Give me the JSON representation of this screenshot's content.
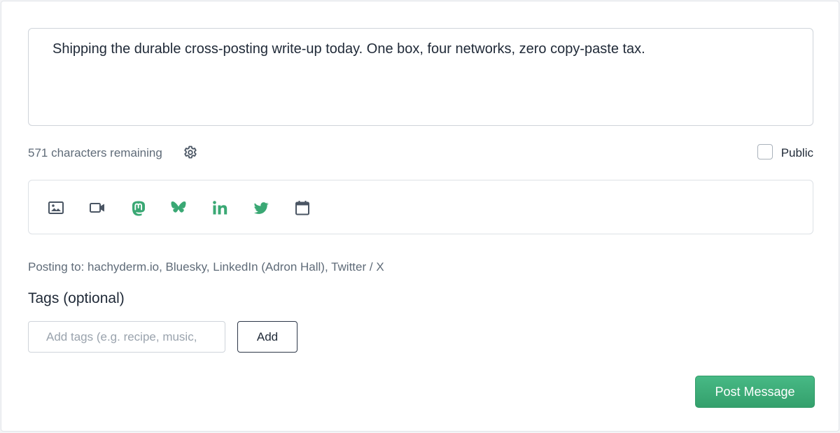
{
  "composer": {
    "text": "Shipping the durable cross-posting write-up today. One box, four networks, zero copy-paste tax."
  },
  "meta": {
    "char_count": "571 characters remaining",
    "public_label": "Public",
    "public_checked": false
  },
  "toolbar": {
    "icons": [
      "image-icon",
      "video-icon",
      "mastodon-icon",
      "bluesky-icon",
      "linkedin-icon",
      "twitter-icon",
      "calendar-icon"
    ]
  },
  "posting": {
    "text": "Posting to: hachyderm.io, Bluesky, LinkedIn (Adron Hall), Twitter / X"
  },
  "tags": {
    "heading": "Tags (optional)",
    "placeholder": "Add tags (e.g. recipe, music, ",
    "add_label": "Add"
  },
  "actions": {
    "post_label": "Post Message"
  },
  "colors": {
    "accent_green": "#3aa874",
    "icon_gray": "#4a5563"
  }
}
